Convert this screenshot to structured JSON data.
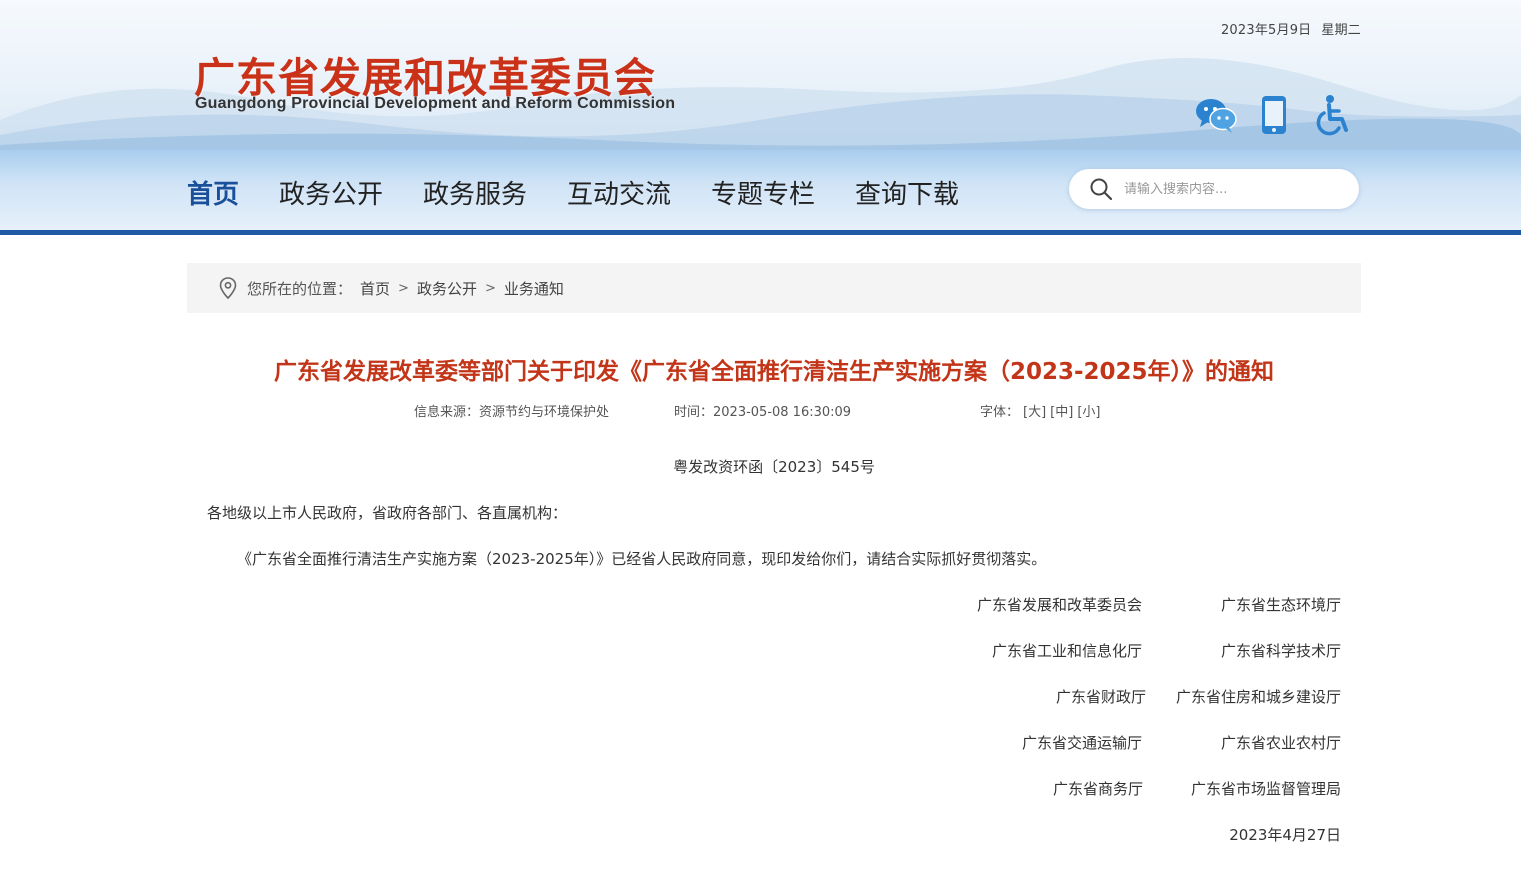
{
  "header": {
    "date": "2023年5月9日",
    "weekday": "星期二",
    "logo_cn": "广东省发展和改革委员会",
    "logo_en": "Guangdong Provincial Development and Reform Commission",
    "icons": [
      "wechat-icon",
      "mobile-icon",
      "accessibility-icon"
    ]
  },
  "nav": {
    "items": [
      "首页",
      "政务公开",
      "政务服务",
      "互动交流",
      "专题专栏",
      "查询下载"
    ],
    "active": "首页"
  },
  "search": {
    "placeholder": "请输入搜索内容..."
  },
  "breadcrumb": {
    "label": "您所在的位置：",
    "items": [
      "首页",
      "政务公开",
      "业务通知"
    ],
    "separator": ">"
  },
  "article": {
    "title": "广东省发展改革委等部门关于印发《广东省全面推行清洁生产实施方案（2023-2025年）》的通知",
    "source": "信息来源：资源节约与环境保护处",
    "time": "时间：2023-05-08 16:30:09",
    "font_label": "字体：",
    "font_sizes": [
      "[大]",
      "[中]",
      "[小]"
    ],
    "doc_number": "粤发改资环函〔2023〕545号",
    "salutation": "各地级以上市人民政府，省政府各部门、各直属机构：",
    "body": "《广东省全面推行清洁生产实施方案（2023-2025年）》已经省人民政府同意，现印发给你们，请结合实际抓好贯彻落实。",
    "signatories": [
      [
        "广东省发展和改革委员会",
        "广东省生态环境厅"
      ],
      [
        "广东省工业和信息化厅",
        "广东省科学技术厅"
      ],
      [
        "广东省财政厅",
        "广东省住房和城乡建设厅"
      ],
      [
        "广东省交通运输厅",
        "广东省农业农村厅"
      ],
      [
        "广东省商务厅",
        "广东省市场监督管理局"
      ]
    ],
    "sign_date": "2023年4月27日"
  },
  "colors": {
    "title_red": "#c23518",
    "logo_red": "#c93218",
    "nav_active": "#1a4f9a",
    "nav_border": "#1f5aa6"
  }
}
